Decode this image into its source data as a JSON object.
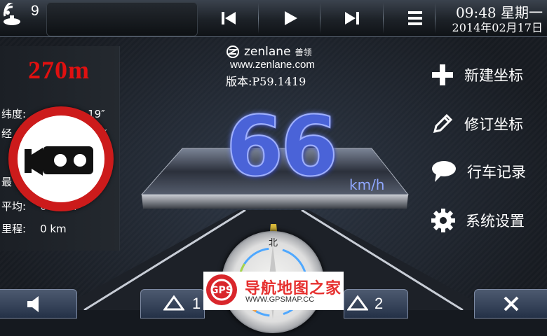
{
  "topbar": {
    "signal_count": "9",
    "time": "09:48 星期一",
    "date": "2014年02月17日",
    "buttons": [
      "prev-icon",
      "play-icon",
      "next-icon",
      "menu-icon"
    ]
  },
  "left": {
    "distance": "270m",
    "lat_label": "纬度:",
    "lat_value": "19″",
    "lon_label": "经",
    "lon_value": "″",
    "max_label": "最",
    "avg_label": "平均:",
    "avg_value": "0 km/h",
    "odo_label": "里程:",
    "odo_value": "0 km"
  },
  "center": {
    "brand": "zenlane",
    "brand_cn": "善领",
    "website": "www.zenlane.com",
    "version": "版本:P59.1419",
    "speed": "66",
    "unit": "km/h",
    "compass_north": "北"
  },
  "menu": [
    {
      "label": "新建坐标",
      "icon": "plus-icon"
    },
    {
      "label": "修订坐标",
      "icon": "pencil-icon"
    },
    {
      "label": "行车记录",
      "icon": "speech-bubble-icon"
    },
    {
      "label": "系统设置",
      "icon": "gear-icon"
    }
  ],
  "bottom": {
    "btn1_num": "1",
    "btn2_num": "2"
  },
  "watermark": {
    "logo": "GPS",
    "text": "导航地图之家",
    "url": "WWW.GPSMAP.CC"
  },
  "colors": {
    "distance": "#e01010",
    "speed": "#4a63d8",
    "camera_ring": "#cc1b1b"
  }
}
